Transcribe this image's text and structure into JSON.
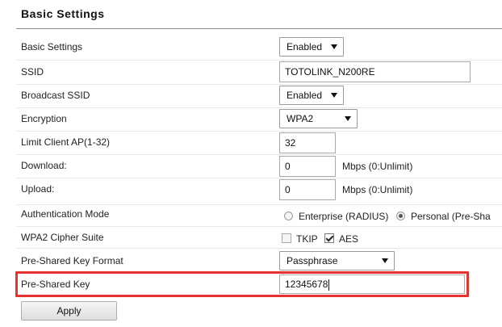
{
  "section": {
    "title": "Basic Settings"
  },
  "rows": {
    "basic_settings": {
      "label": "Basic Settings",
      "value": "Enabled"
    },
    "ssid": {
      "label": "SSID",
      "value": "TOTOLINK_N200RE"
    },
    "broadcast_ssid": {
      "label": "Broadcast SSID",
      "value": "Enabled"
    },
    "encryption": {
      "label": "Encryption",
      "value": "WPA2"
    },
    "limit_client": {
      "label": "Limit Client AP(1-32)",
      "value": "32"
    },
    "download": {
      "label": "Download:",
      "value": "0",
      "unit": "Mbps (0:Unlimit)"
    },
    "upload": {
      "label": "Upload:",
      "value": "0",
      "unit": "Mbps (0:Unlimit)"
    },
    "auth_mode": {
      "label": "Authentication Mode",
      "options": [
        "Enterprise (RADIUS)",
        "Personal (Pre-Sha"
      ],
      "selected": "Personal (Pre-Sha"
    },
    "cipher": {
      "label": "WPA2 Cipher Suite",
      "options": [
        {
          "label": "TKIP",
          "checked": false
        },
        {
          "label": "AES",
          "checked": true
        }
      ]
    },
    "psk_format": {
      "label": "Pre-Shared Key Format",
      "value": "Passphrase"
    },
    "psk": {
      "label": "Pre-Shared Key",
      "value": "12345678"
    }
  },
  "apply_label": "Apply",
  "colors": {
    "highlight": "#e8322d",
    "title_rule": "#8a8a8a"
  }
}
